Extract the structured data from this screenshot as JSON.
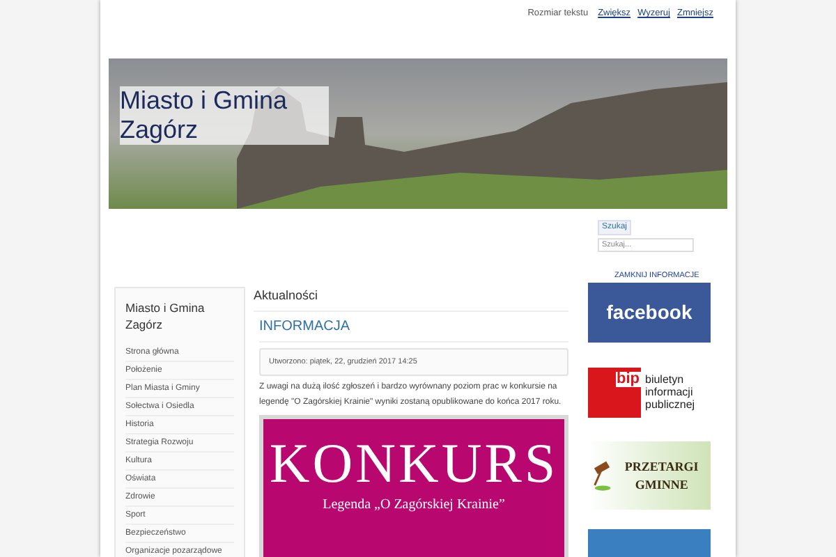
{
  "text_size": {
    "label": "Rozmiar tekstu",
    "links": [
      "Zwiększ",
      "Wyzeruj",
      "Zmniejsz"
    ]
  },
  "header": {
    "title": "Miasto i Gmina Zagórz"
  },
  "search": {
    "button": "Szukaj",
    "placeholder": "Szukaj..."
  },
  "sidebar": {
    "title": "Miasto i Gmina Zagórz",
    "items": [
      "Strona główna",
      "Położenie",
      "Plan Miasta i Gminy",
      "Sołectwa i Osiedla",
      "Historia",
      "Strategia Rozwoju",
      "Kultura",
      "Oświata",
      "Zdrowie",
      "Sport",
      "Bezpieczeństwo",
      "Organizacje pozarządowe"
    ]
  },
  "content": {
    "heading": "Aktualności",
    "article_title": "INFORMACJA",
    "meta": "Utworzono: piątek, 22, grudzień 2017 14:25",
    "body": "Z uwagi na dużą ilość zgłoszeń i bardzo wyrównany poziom prac w konkursie na legendę \"O Zagórskiej Krainie\" wyniki zostaną opublikowane do końca 2017 roku.",
    "banner": {
      "title": "KONKURS",
      "subtitle": "Legenda „O Zagórskiej Krainie”"
    }
  },
  "right_banners": [
    {
      "kind": "facebook",
      "overlay": "ZAMKNIJ INFORMACJE",
      "text": "facebook"
    },
    {
      "kind": "bip",
      "logo": "bip",
      "text": "biuletyn informacji publicznej"
    },
    {
      "kind": "tenders",
      "text": "PRZETARGI GMINNE"
    },
    {
      "kind": "image"
    }
  ]
}
